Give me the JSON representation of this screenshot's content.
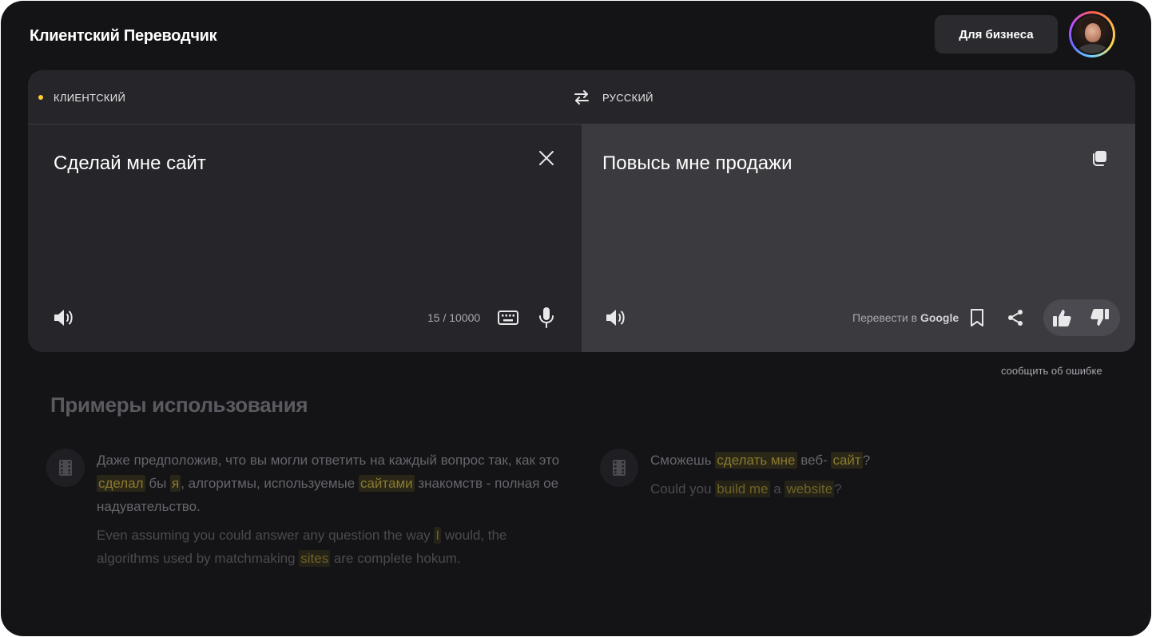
{
  "header": {
    "title": "Клиентский Переводчик",
    "business_label": "Для бизнеса"
  },
  "translator": {
    "source_lang": "КЛИЕНТСКИЙ",
    "target_lang": "РУССКИЙ",
    "source_text": "Сделай мне сайт",
    "target_text": "Повысь мне продажи",
    "char_count": "15 / 10000",
    "google_prefix": "Перевести в ",
    "google_brand": "Google",
    "report_error": "сообщить об ошибке"
  },
  "examples": {
    "title": "Примеры использования",
    "items": [
      {
        "ru": [
          {
            "t": "Даже предположив, что вы могли ответить на каждый вопрос так, как это ",
            "hl": false
          },
          {
            "t": "сделал",
            "hl": true
          },
          {
            "t": " бы ",
            "hl": false
          },
          {
            "t": "я",
            "hl": true
          },
          {
            "t": ", алгоритмы, используемые ",
            "hl": false
          },
          {
            "t": "сайтами",
            "hl": true
          },
          {
            "t": " знакомств - полная ое надувательство.",
            "hl": false
          }
        ],
        "en": [
          {
            "t": "Even assuming you could answer any question the way ",
            "hl": false
          },
          {
            "t": "I",
            "hl": true
          },
          {
            "t": " would, the algorithms used by matchmaking ",
            "hl": false
          },
          {
            "t": "sites",
            "hl": true
          },
          {
            "t": " are complete hokum.",
            "hl": false
          }
        ]
      },
      {
        "ru": [
          {
            "t": "Сможешь ",
            "hl": false
          },
          {
            "t": "сделать мне",
            "hl": true
          },
          {
            "t": " веб- ",
            "hl": false
          },
          {
            "t": "сайт",
            "hl": true
          },
          {
            "t": "?",
            "hl": false
          }
        ],
        "en": [
          {
            "t": "Could you ",
            "hl": false
          },
          {
            "t": "build me",
            "hl": true
          },
          {
            "t": " a ",
            "hl": false
          },
          {
            "t": "website",
            "hl": true
          },
          {
            "t": "?",
            "hl": false
          }
        ]
      }
    ]
  },
  "colors": {
    "background": "#141417",
    "card": "#26262a",
    "target_pane": "#3a3a3f",
    "accent_dot": "#ffcc33",
    "highlight_text": "#8a7a2e"
  },
  "icons": {
    "swap": "swap-arrows-icon",
    "clear": "close-icon",
    "speak": "speaker-icon",
    "keyboard": "keyboard-icon",
    "mic": "microphone-icon",
    "copy": "copy-icon",
    "bookmark": "bookmark-icon",
    "share": "share-icon",
    "like": "thumbs-up-icon",
    "dislike": "thumbs-down-icon",
    "example": "film-icon"
  }
}
